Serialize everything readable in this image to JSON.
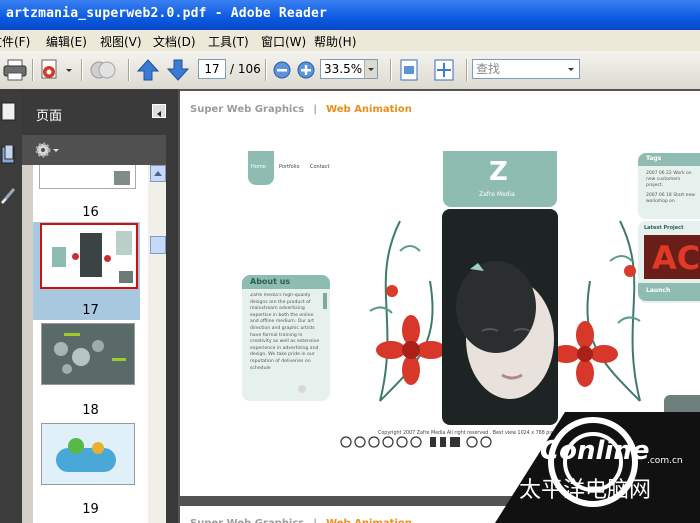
{
  "window": {
    "title": "artzmania_superweb2.0.pdf - Adobe Reader"
  },
  "menu": [
    {
      "label": "文件(F)"
    },
    {
      "label": "编辑(E)"
    },
    {
      "label": "视图(V)"
    },
    {
      "label": "文档(D)"
    },
    {
      "label": "工具(T)"
    },
    {
      "label": "窗口(W)"
    },
    {
      "label": "帮助(H)"
    }
  ],
  "toolbar": {
    "page_value": "17",
    "page_total": "/ 106",
    "zoom_value": "33.5%",
    "search_placeholder": "查找"
  },
  "nav_panel": {
    "title": "页面",
    "thumbnails": [
      {
        "page": "16"
      },
      {
        "page": "17"
      },
      {
        "page": "18"
      },
      {
        "page": "19"
      }
    ]
  },
  "document": {
    "header_left": "Super Web Graphics",
    "header_sep": "|",
    "header_right": "Web Animation",
    "site": {
      "nav": [
        "Home",
        "Portfolio",
        "Contact"
      ],
      "brand": "Zafre Media",
      "about_title": "About us",
      "about_text": "Zafre media's high-quality designs are the product of mainstream advertising expertise in both the online and offline medium. Our art direction and graphic artists have formal training in creativity as well as extensive experience in advertising and design. We take pride in our reputation of deliveries on schedule",
      "tags_title": "Tags",
      "tags": [
        "2007 06 22 Work on new customers project.",
        "2007 06 18 Start new workshop on"
      ],
      "latest_title": "Latest Project",
      "launch": "Launch",
      "copyright": "Copyright 2007 Zafre Media All right reserved . Best view 1024 x 768 pixels Font"
    }
  },
  "watermark": {
    "brand": "PConline",
    "domain": ".com.cn",
    "cn": "太平洋电脑网"
  },
  "colors": {
    "titlebar": "#0a5ae0",
    "accent_orange": "#e88f1a",
    "teal": "#8fbcb0",
    "selection": "#a8c8e0"
  }
}
